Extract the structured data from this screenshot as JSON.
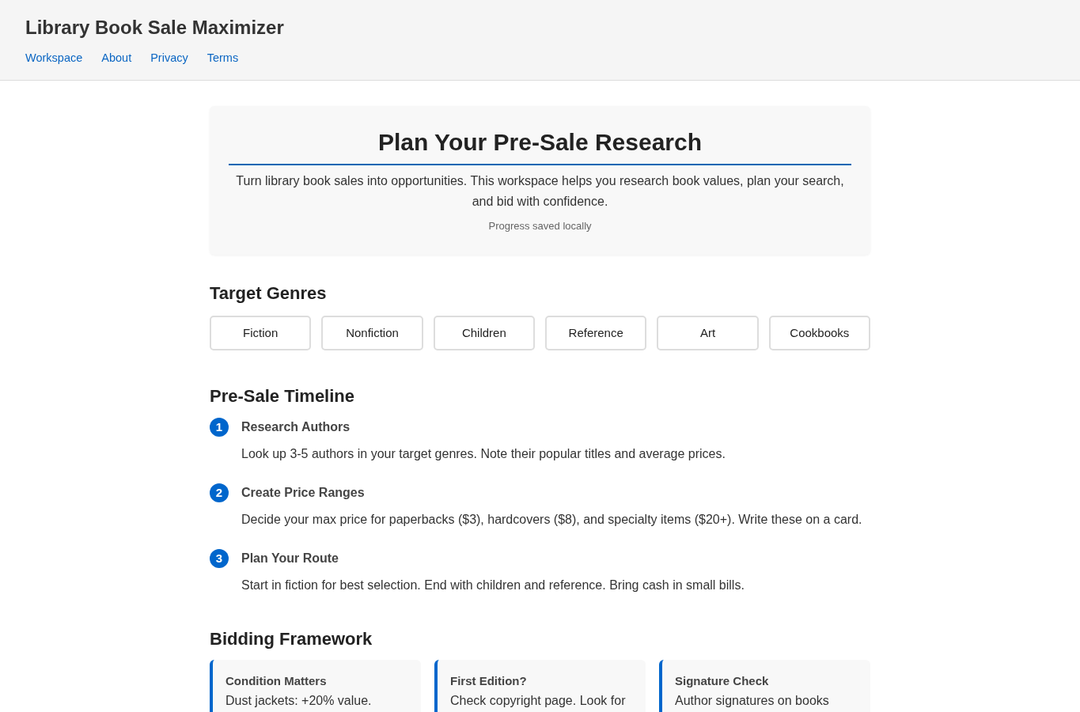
{
  "header": {
    "title": "Library Book Sale Maximizer",
    "nav": [
      "Workspace",
      "About",
      "Privacy",
      "Terms"
    ]
  },
  "hero": {
    "title": "Plan Your Pre-Sale Research",
    "description": "Turn library book sales into opportunities. This workspace helps you research book values, plan your search, and bid with confidence.",
    "status": "Progress saved locally"
  },
  "genres": {
    "heading": "Target Genres",
    "options": [
      "Fiction",
      "Nonfiction",
      "Children",
      "Reference",
      "Art",
      "Cookbooks"
    ]
  },
  "timeline": {
    "heading": "Pre-Sale Timeline",
    "steps": [
      {
        "number": "1",
        "title": "Research Authors",
        "description": "Look up 3-5 authors in your target genres. Note their popular titles and average prices."
      },
      {
        "number": "2",
        "title": "Create Price Ranges",
        "description": "Decide your max price for paperbacks ($3), hardcovers ($8), and specialty items ($20+). Write these on a card."
      },
      {
        "number": "3",
        "title": "Plan Your Route",
        "description": "Start in fiction for best selection. End with children and reference. Bring cash in small bills."
      }
    ]
  },
  "bidding": {
    "heading": "Bidding Framework",
    "cards": [
      {
        "title": "Condition Matters",
        "text": "Dust jackets: +20% value."
      },
      {
        "title": "First Edition?",
        "text": "Check copyright page. Look for"
      },
      {
        "title": "Signature Check",
        "text": "Author signatures on books"
      }
    ]
  }
}
